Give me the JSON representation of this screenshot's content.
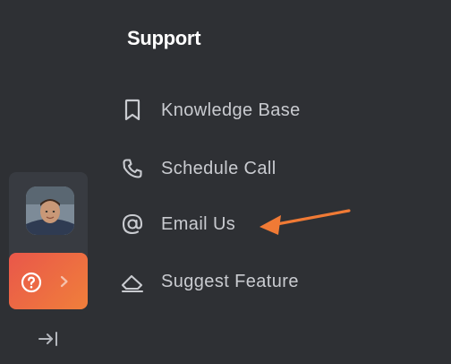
{
  "panel": {
    "title": "Support"
  },
  "menu": {
    "items": [
      {
        "label": "Knowledge Base",
        "icon": "bookmark-icon"
      },
      {
        "label": "Schedule Call",
        "icon": "phone-icon"
      },
      {
        "label": "Email Us",
        "icon": "at-sign-icon"
      },
      {
        "label": "Suggest Feature",
        "icon": "eraser-icon"
      }
    ]
  },
  "rail": {
    "avatar": "user-avatar",
    "help_icon": "question-circle-icon",
    "help_chevron": "chevron-right-icon",
    "collapse_icon": "collapse-right-icon"
  },
  "annotation": {
    "arrow_color": "#f07a35",
    "points_to": "Email Us"
  },
  "colors": {
    "background": "#2e3034",
    "rail_card": "#383b41",
    "help_gradient_start": "#e9574a",
    "help_gradient_end": "#f07f3b",
    "menu_text": "#c9cbd0",
    "title_text": "#ffffff"
  }
}
